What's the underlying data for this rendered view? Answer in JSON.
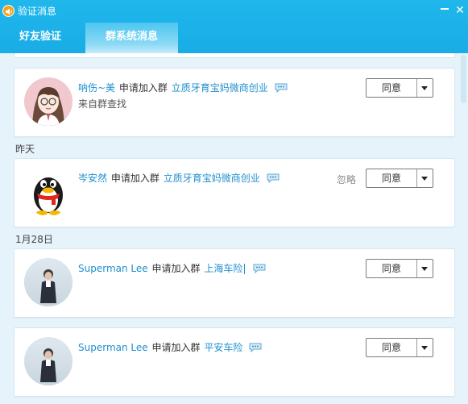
{
  "window": {
    "title": "验证消息",
    "icons": {
      "app": "speaker-icon",
      "minimize": "minimize-icon",
      "close": "close-icon"
    }
  },
  "tabs": [
    {
      "label": "好友验证",
      "active": false
    },
    {
      "label": "群系统消息",
      "active": true
    }
  ],
  "dates": {
    "yesterday": "昨天",
    "jan28": "1月28日"
  },
  "requests": [
    {
      "nickname": "呐伤~美",
      "action": "申请加入群",
      "group": "立质牙育宝妈微商创业",
      "source": "来自群查找",
      "ignore": "",
      "agree": "同意",
      "avatar": "cartoon-girl-avatar"
    },
    {
      "nickname": "岑安然",
      "action": "申请加入群",
      "group": "立质牙育宝妈微商创业",
      "source": "",
      "ignore": "忽略",
      "agree": "同意",
      "avatar": "qq-penguin-avatar"
    },
    {
      "nickname": "Superman Lee",
      "action": "申请加入群",
      "group": "上海车险",
      "source": "",
      "ignore": "",
      "agree": "同意",
      "avatar": "man-photo-avatar"
    },
    {
      "nickname": "Superman Lee",
      "action": "申请加入群",
      "group": "平安车险",
      "source": "",
      "ignore": "",
      "agree": "同意",
      "avatar": "man-photo-avatar"
    }
  ],
  "colors": {
    "titlebar": "#19ace6",
    "link": "#1f8fce",
    "background": "#e6f3fa"
  }
}
